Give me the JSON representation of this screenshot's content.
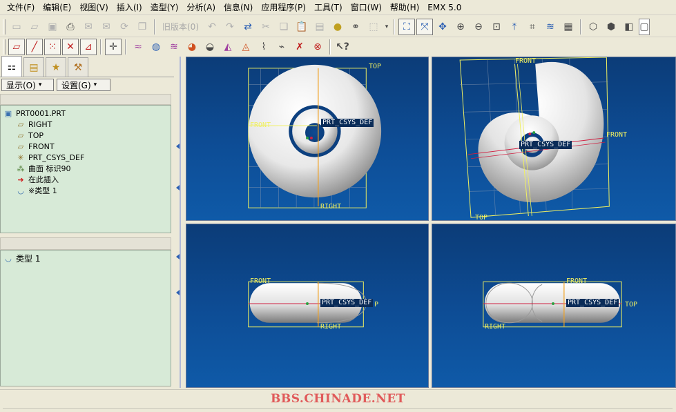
{
  "menu": [
    {
      "label": "文件(F)"
    },
    {
      "label": "编辑(E)"
    },
    {
      "label": "视图(V)"
    },
    {
      "label": "插入(I)"
    },
    {
      "label": "造型(Y)"
    },
    {
      "label": "分析(A)"
    },
    {
      "label": "信息(N)"
    },
    {
      "label": "应用程序(P)"
    },
    {
      "label": "工具(T)"
    },
    {
      "label": "窗口(W)"
    },
    {
      "label": "帮助(H)"
    },
    {
      "label": "EMX 5.0"
    }
  ],
  "toolbar": {
    "revision_label": "旧版本(0)"
  },
  "panel": {
    "show_button": "显示(O)",
    "settings_button": "设置(G)"
  },
  "model_tree": [
    {
      "label": "PRT0001.PRT",
      "icon": "part-icon"
    },
    {
      "label": "RIGHT",
      "icon": "datum-plane-icon"
    },
    {
      "label": "TOP",
      "icon": "datum-plane-icon"
    },
    {
      "label": "FRONT",
      "icon": "datum-plane-icon"
    },
    {
      "label": "PRT_CSYS_DEF",
      "icon": "csys-icon"
    },
    {
      "label": "曲面 标识90",
      "icon": "surface-icon"
    },
    {
      "label": "在此插入",
      "icon": "insert-here-arrow-icon"
    },
    {
      "label": "※类型 1",
      "icon": "layer-icon"
    }
  ],
  "layer_tree": [
    {
      "label": "类型 1",
      "icon": "layer-icon"
    }
  ],
  "viewports": {
    "top_left": {
      "labels": [
        "TOP",
        "FRONT",
        "RIGHT"
      ],
      "csys": "PRT_CSYS_DEF"
    },
    "top_right": {
      "labels": [
        "FRONT",
        "TOP",
        "FRONT"
      ],
      "csys": "PRT_CSYS_DEF"
    },
    "bottom_left": {
      "labels": [
        "FRONT",
        "RIGHT",
        "P"
      ],
      "csys": "PRT_CSYS_DEF"
    },
    "bottom_right": {
      "labels": [
        "FRONT",
        "RIGHT",
        "TOP"
      ],
      "csys": "PRT_CSYS_DEF"
    }
  },
  "watermark": "BBS.CHINADE.NET",
  "colors": {
    "datum": "#f0f060",
    "viewport_top": "#0c3c78",
    "viewport_bottom": "#0f5aa8",
    "tree_bg": "#d7ead7",
    "watermark": "#e05a5a"
  }
}
